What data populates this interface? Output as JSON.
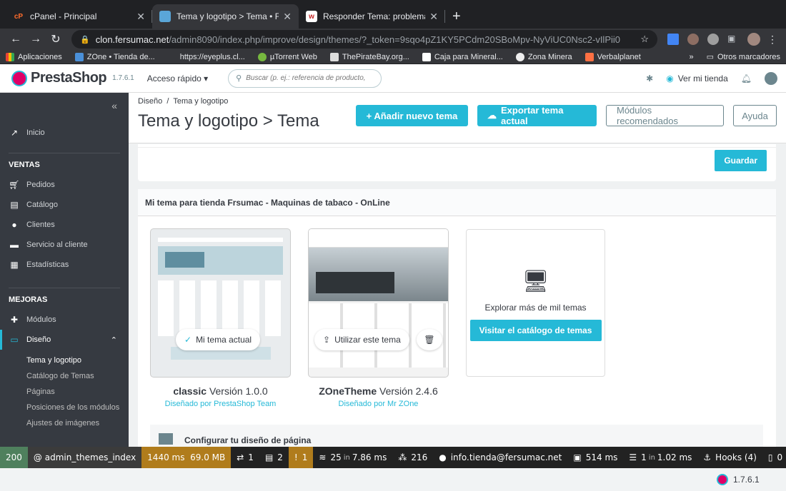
{
  "browser": {
    "tabs": [
      {
        "title": "cPanel - Principal",
        "color": "#ff6c2c",
        "glyph": "cP"
      },
      {
        "title": "Tema y logotipo > Tema • Fersu",
        "color": "#5aa6d8",
        "glyph": ""
      },
      {
        "title": "Responder Tema: problemas co",
        "color": "#c62828",
        "glyph": "w"
      }
    ],
    "url_host": "clon.fersumac.net",
    "url_path": "/admin8090/index.php/improve/design/themes/?_token=9sqo4pZ1KY5PCdm20SBoMpv-NyViUC0Nsc2-vIlPii0",
    "bookmarks": [
      "Aplicaciones",
      "ZOne • Tienda de...",
      "https://eyeplus.cl...",
      "µTorrent Web",
      "ThePirateBay.org...",
      "Caja para Mineral...",
      "Zona Minera",
      "Verbalplanet"
    ],
    "bookmarks_more": "»",
    "other_bookmarks": "Otros marcadores"
  },
  "header": {
    "brand": "PrestaShop",
    "version": "1.7.6.1",
    "quick_access": "Acceso rápido",
    "search_placeholder": "Buscar (p. ej.: referencia de producto, nombre de cliente...)",
    "view_store": "Ver mi tienda"
  },
  "sidebar": {
    "collapse": "«",
    "home": "Inicio",
    "sales_title": "VENTAS",
    "sales": [
      "Pedidos",
      "Catálogo",
      "Clientes",
      "Servicio al cliente",
      "Estadísticas"
    ],
    "improve_title": "MEJORAS",
    "modules": "Módulos",
    "design": "Diseño",
    "design_sub": [
      "Tema y logotipo",
      "Catálogo de Temas",
      "Páginas",
      "Posiciones de los módulos",
      "Ajustes de imágenes"
    ]
  },
  "page": {
    "breadcrumb_1": "Diseño",
    "breadcrumb_2": "Tema y logotipo",
    "title": "Tema y logotipo > Tema",
    "btn_add": "+ Añadir nuevo tema",
    "btn_export": "Exportar tema actual",
    "btn_modules": "Módulos recomendados",
    "btn_help": "Ayuda",
    "save": "Guardar",
    "card_title": "Mi tema para tienda Frsumac - Maquinas de tabaco - OnLine",
    "themes": [
      {
        "name": "classic",
        "version": "Versión 1.0.0",
        "author": "Diseñado por PrestaShop Team",
        "action": "Mi tema actual"
      },
      {
        "name": "ZOneTheme",
        "version": "Versión 2.4.6",
        "author": "Diseñado por Mr ZOne",
        "action": "Utilizar este tema"
      }
    ],
    "explore_text": "Explorar más de mil temas",
    "explore_btn": "Visitar el catálogo de temas",
    "configure": "Configurar tu diseño de página"
  },
  "debugbar": {
    "status": "200",
    "route": "@ admin_themes_index",
    "time": "1440 ms",
    "memory": "69.0 MB",
    "forms": "1",
    "twig": "2",
    "alerts": "1",
    "db": "25",
    "db_in": "in",
    "db_time": "7.86 ms",
    "translations": "216",
    "user": "info.tienda@fersumac.net",
    "render": "514 ms",
    "cache": "1",
    "cache_in": "in",
    "cache_time": "1.02 ms",
    "hooks": "Hooks (4)",
    "modules": "0",
    "ps_version": "1.7.6.1"
  }
}
